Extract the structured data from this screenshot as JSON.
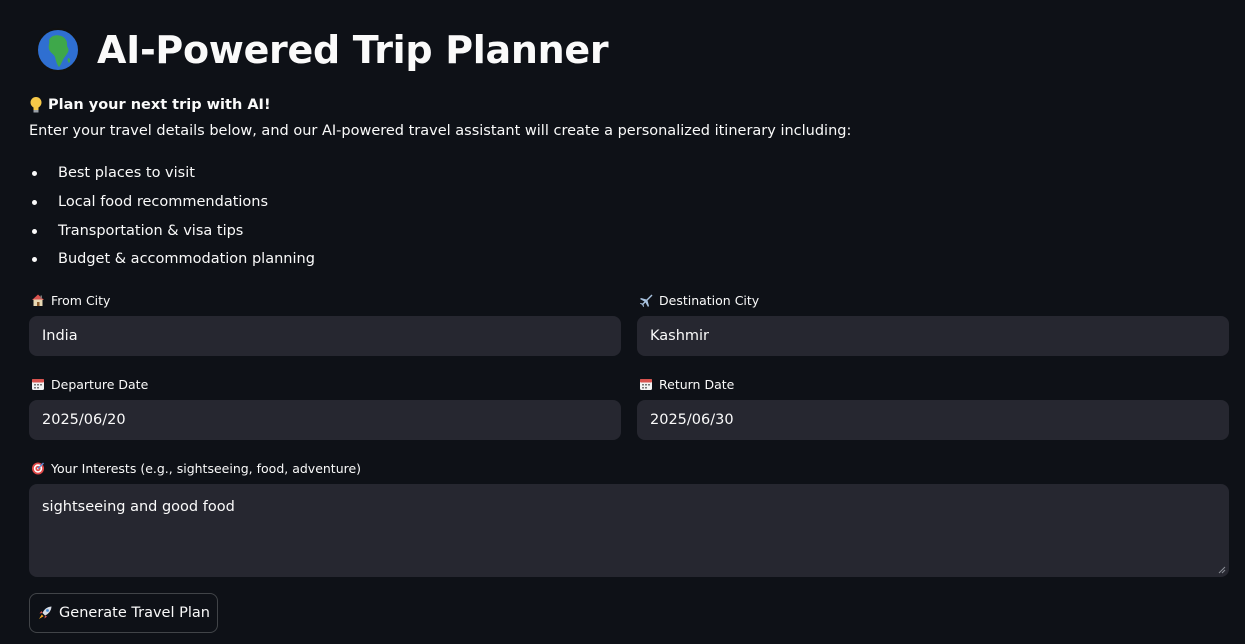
{
  "header": {
    "title": "AI-Powered Trip Planner",
    "icon": "globe-africa-icon"
  },
  "intro": {
    "heading": "Plan your next trip with AI!",
    "heading_icon": "lightbulb-icon",
    "description": "Enter your travel details below, and our AI-powered travel assistant will create a personalized itinerary including:"
  },
  "features": [
    "Best places to visit",
    "Local food recommendations",
    "Transportation & visa tips",
    "Budget & accommodation planning"
  ],
  "form": {
    "from_city": {
      "label": "From City",
      "icon": "house-icon",
      "value": "India"
    },
    "destination_city": {
      "label": "Destination City",
      "icon": "airplane-icon",
      "value": "Kashmir"
    },
    "departure_date": {
      "label": "Departure Date",
      "icon": "calendar-icon",
      "value": "2025/06/20"
    },
    "return_date": {
      "label": "Return Date",
      "icon": "calendar-icon",
      "value": "2025/06/30"
    },
    "interests": {
      "label": "Your Interests (e.g., sightseeing, food, adventure)",
      "icon": "target-icon",
      "value": "sightseeing and good food"
    },
    "submit": {
      "label": "Generate Travel Plan",
      "icon": "rocket-icon"
    }
  },
  "colors": {
    "background": "#0e1117",
    "input_background": "#262730",
    "text": "#fafafa"
  }
}
